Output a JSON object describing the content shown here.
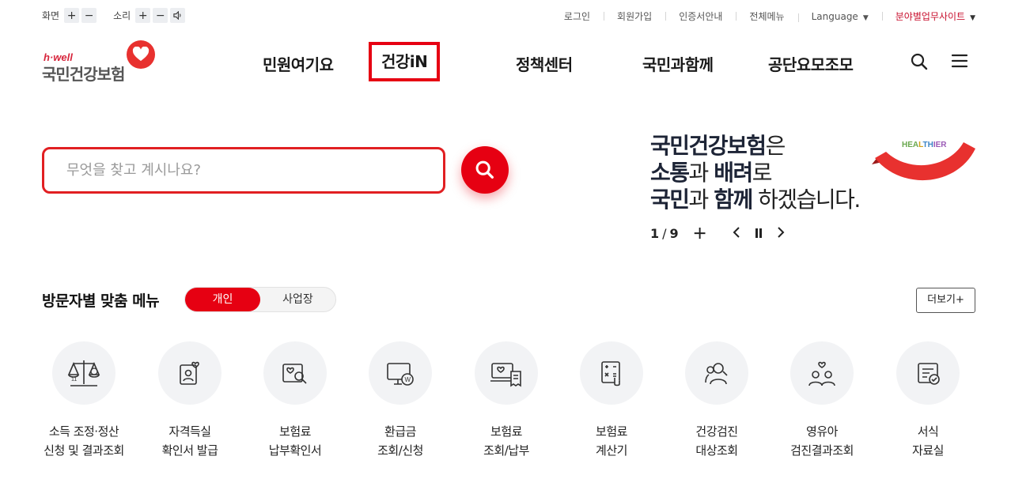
{
  "util": {
    "screen_label": "화면",
    "sound_label": "소리",
    "plus": "+",
    "minus": "−",
    "links": [
      "로그인",
      "회원가입",
      "인증서안내",
      "전체메뉴",
      "Language"
    ],
    "site_link": "분야별업무사이트"
  },
  "logo": {
    "tagline": "h·well",
    "name": "국민건강보험"
  },
  "gnb": [
    "민원여기요",
    "건강iN",
    "정책센터",
    "국민과함께",
    "공단요모조모"
  ],
  "search": {
    "placeholder": "무엇을 찾고 계시나요?"
  },
  "slogan": {
    "l1a": "국민건강보험",
    "l1b": "은",
    "l2a": "소통",
    "l2b": "과 ",
    "l2c": "배려",
    "l2d": "로",
    "l3a": "국민",
    "l3b": "과 ",
    "l3c": "함께",
    "l3d": " 하겠습니다.",
    "banner_word": "HEALTHIER"
  },
  "slider": {
    "current": "1",
    "total": "9"
  },
  "visitor": {
    "title": "방문자별 맞춤 메뉴",
    "tabs": [
      "개인",
      "사업장"
    ],
    "more": "더보기+",
    "items": [
      {
        "l1": "소득 조정·정산",
        "l2": "신청 및 결과조회",
        "icon": "scale-icon"
      },
      {
        "l1": "자격득실",
        "l2": "확인서 발급",
        "icon": "id-card-heart-icon"
      },
      {
        "l1": "보험료",
        "l2": "납부확인서",
        "icon": "document-search-icon"
      },
      {
        "l1": "환급금",
        "l2": "조회/신청",
        "icon": "monitor-won-icon"
      },
      {
        "l1": "보험료",
        "l2": "조회/납부",
        "icon": "computer-receipt-icon"
      },
      {
        "l1": "보험료",
        "l2": "계산기",
        "icon": "calculator-icon"
      },
      {
        "l1": "건강검진",
        "l2": "대상조회",
        "icon": "people-search-icon"
      },
      {
        "l1": "영유아",
        "l2": "검진결과조회",
        "icon": "family-heart-icon"
      },
      {
        "l1": "서식",
        "l2": "자료실",
        "icon": "form-check-icon"
      }
    ]
  },
  "colors": {
    "brand_red": "#e60012",
    "dark_text": "#1d2436"
  }
}
